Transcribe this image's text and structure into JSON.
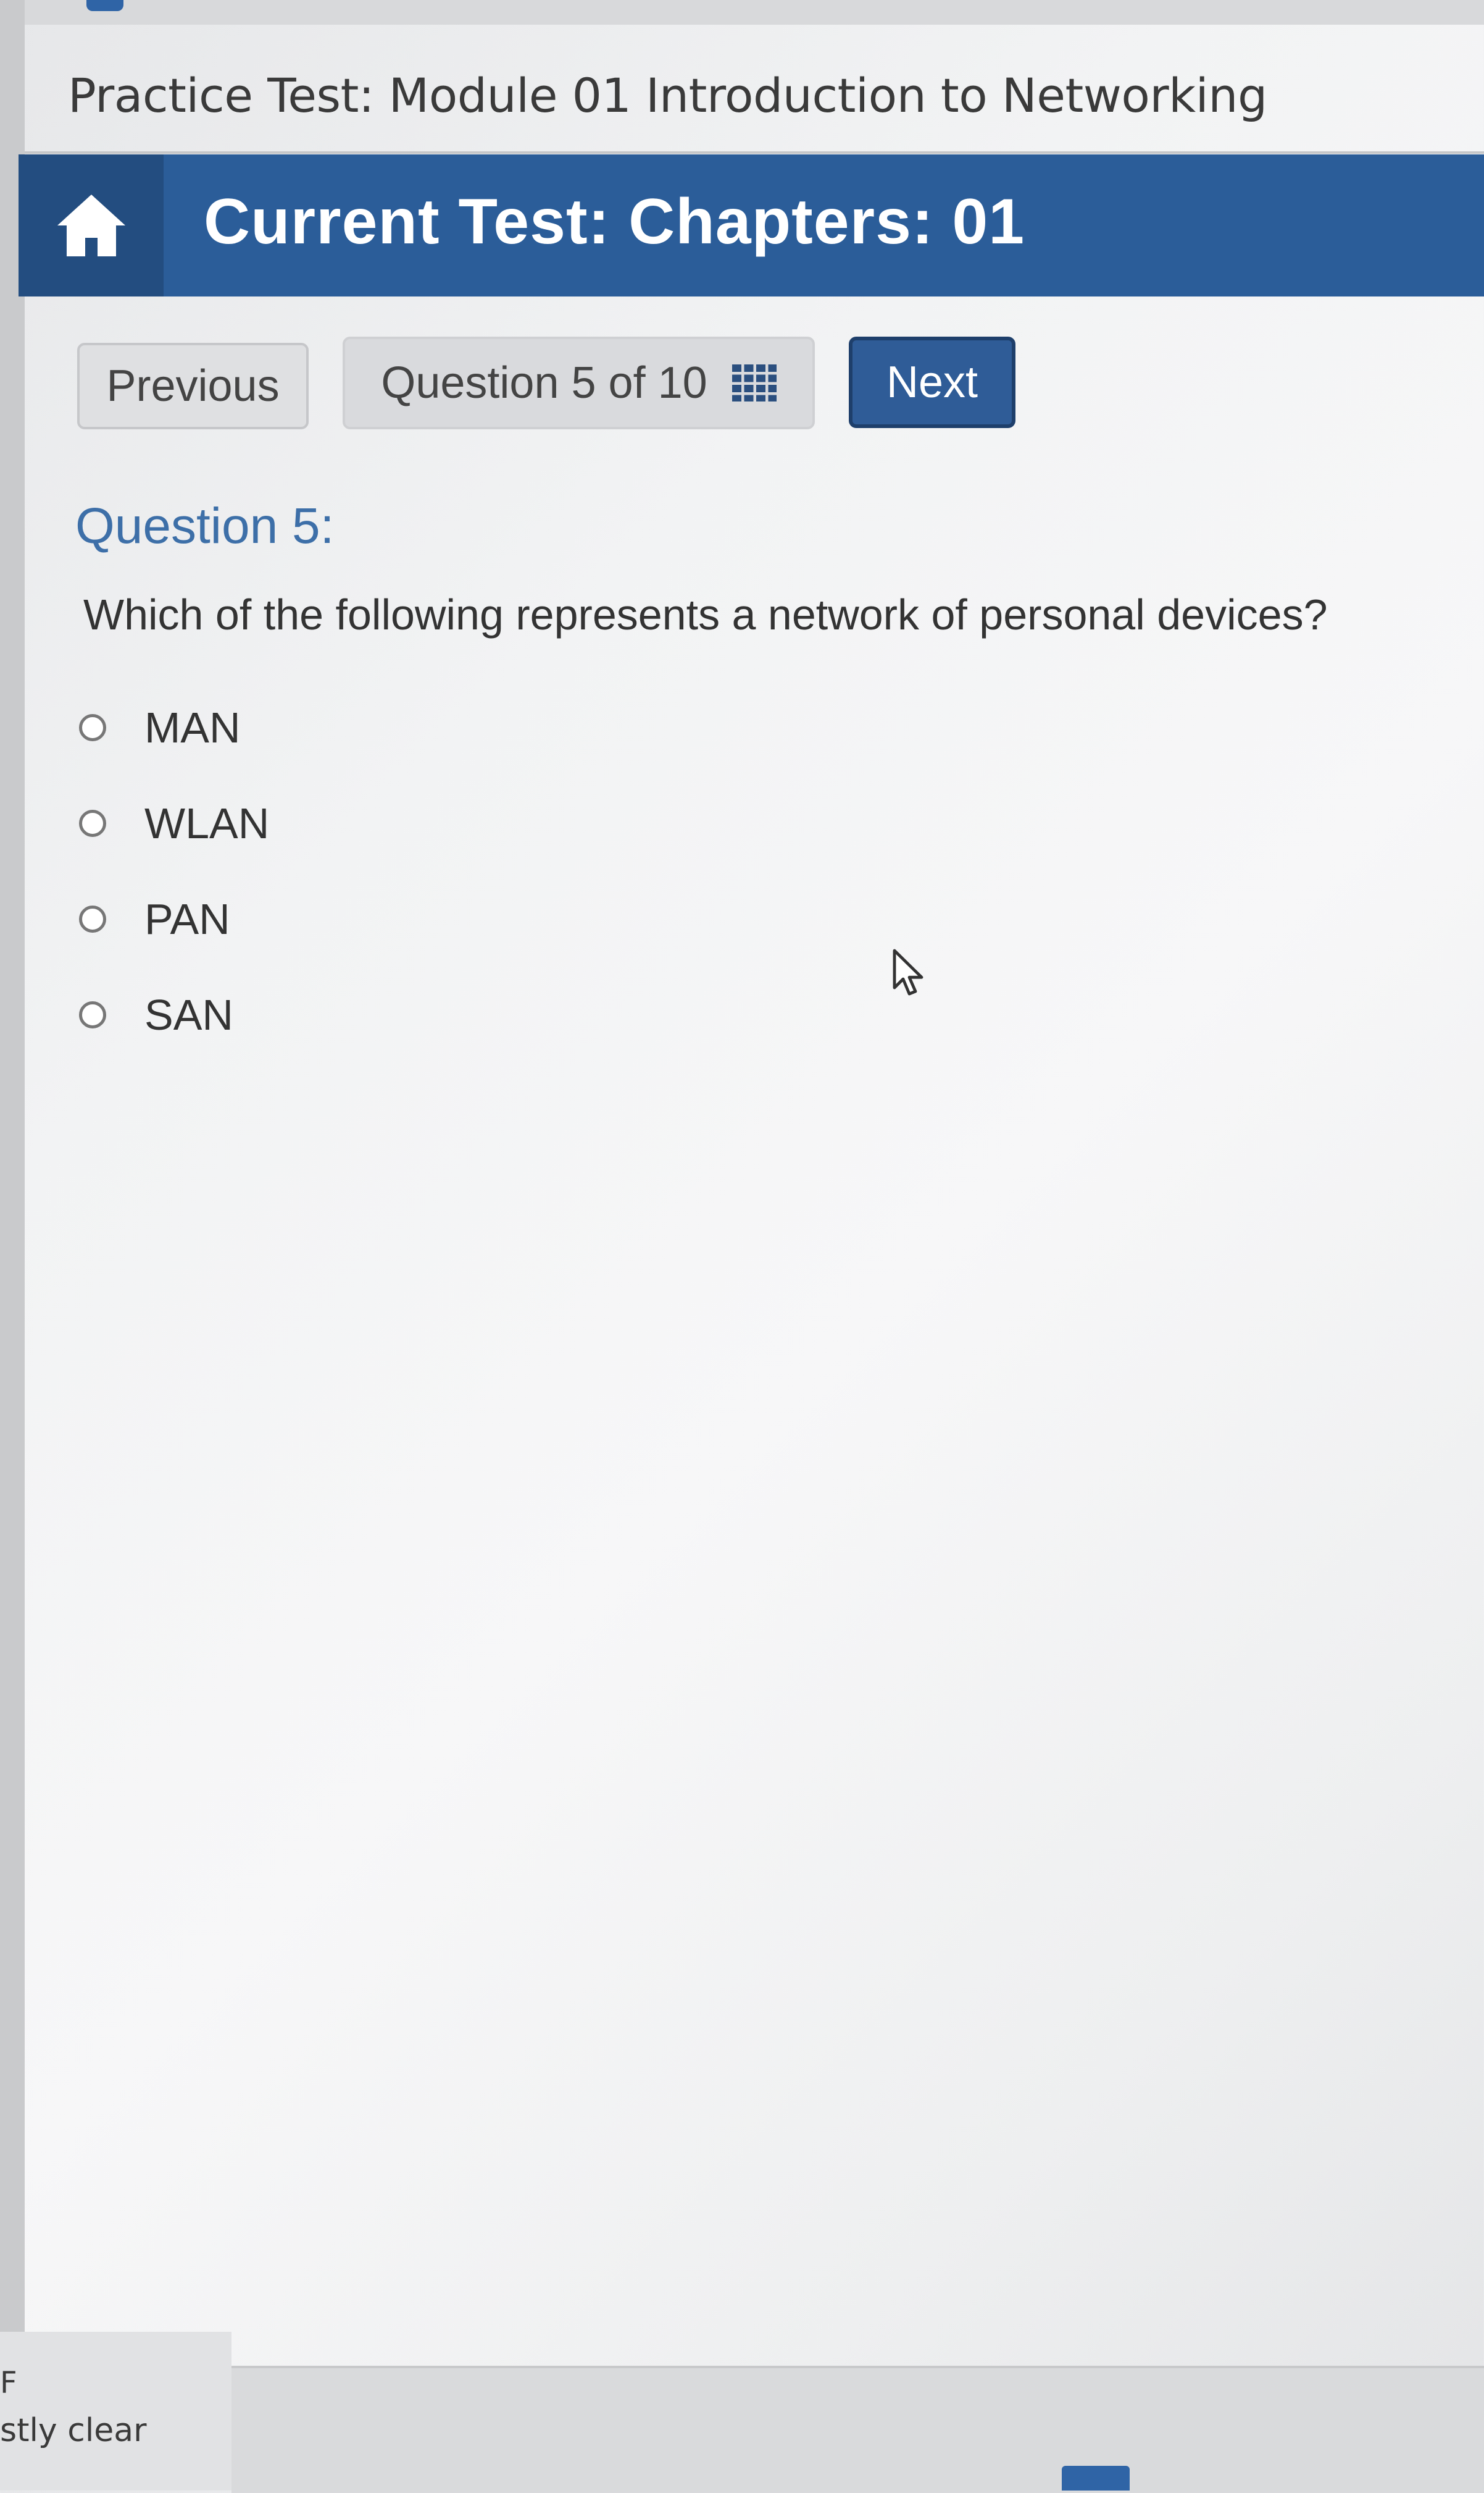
{
  "page": {
    "title": "Practice Test: Module 01 Introduction to Networking"
  },
  "header": {
    "home_icon": "home-icon",
    "title": "Current Test: Chapters: 01"
  },
  "navigation": {
    "previous_label": "Previous",
    "counter_label": "Question 5 of 10",
    "counter_icon": "grid-icon",
    "next_label": "Next"
  },
  "question": {
    "heading": "Question 5:",
    "text": "Which of the following represents a network of personal devices?",
    "options": [
      {
        "label": "MAN",
        "selected": false
      },
      {
        "label": "WLAN",
        "selected": false
      },
      {
        "label": "PAN",
        "selected": false
      },
      {
        "label": "SAN",
        "selected": false
      }
    ]
  },
  "footer": {
    "letter": "F",
    "status": "stly clear"
  },
  "colors": {
    "header_bg": "#2b5d99",
    "home_bg": "#234d80",
    "next_button_bg": "#2f5c97",
    "question_heading": "#3d6fa8"
  }
}
